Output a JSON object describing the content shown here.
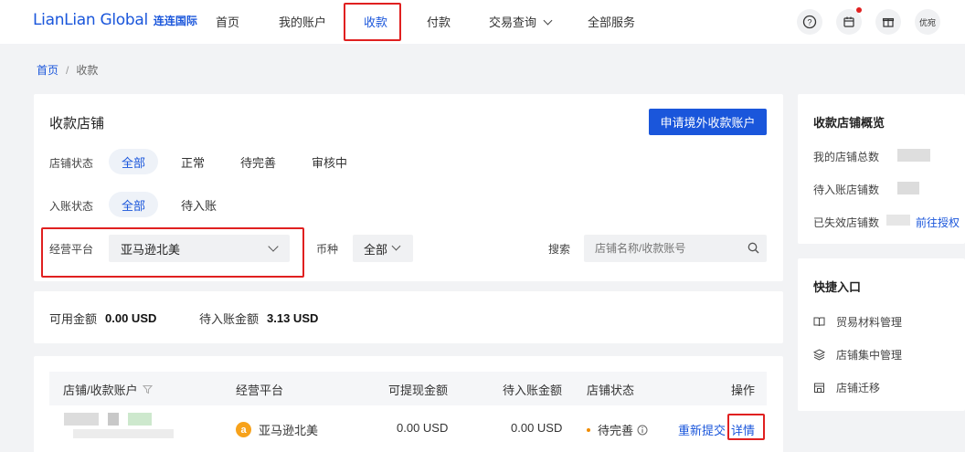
{
  "header": {
    "logo_en": "LianLian Global",
    "logo_cn": "连连国际",
    "nav": [
      "首页",
      "我的账户",
      "收款",
      "付款",
      "交易查询",
      "全部服务"
    ],
    "avatar_text": "优宛"
  },
  "breadcrumb": {
    "home": "首页",
    "sep": "/",
    "current": "收款"
  },
  "stores": {
    "title": "收款店铺",
    "apply_button": "申请境外收款账户",
    "store_status_label": "店铺状态",
    "store_status_options": [
      "全部",
      "正常",
      "待完善",
      "审核中"
    ],
    "account_status_label": "入账状态",
    "account_status_options": [
      "全部",
      "待入账"
    ],
    "platform_label": "经营平台",
    "platform_value": "亚马逊北美",
    "currency_label": "币种",
    "currency_value": "全部",
    "search_label": "搜索",
    "search_placeholder": "店铺名称/收款账号"
  },
  "balance": {
    "available_label": "可用金额",
    "available_value": "0.00 USD",
    "pending_label": "待入账金额",
    "pending_value": "3.13 USD"
  },
  "table": {
    "headers": [
      "店铺/收款账户",
      "经营平台",
      "可提现金额",
      "待入账金额",
      "店铺状态",
      "操作"
    ],
    "row": {
      "platform_icon": "a",
      "platform": "亚马逊北美",
      "withdrawable": "0.00 USD",
      "pending": "0.00 USD",
      "status": "待完善",
      "action_resubmit": "重新提交",
      "action_detail": "详情"
    }
  },
  "overview": {
    "title": "收款店铺概览",
    "total_label": "我的店铺总数",
    "pending_label": "待入账店铺数",
    "expired_label": "已失效店铺数",
    "authorize_link": "前往授权"
  },
  "quick": {
    "title": "快捷入口",
    "items": [
      "贸易材料管理",
      "店铺集中管理",
      "店铺迁移"
    ]
  },
  "colors": {
    "accent": "#1a56db",
    "highlight": "#e02020",
    "status_warning": "#f08c00"
  }
}
